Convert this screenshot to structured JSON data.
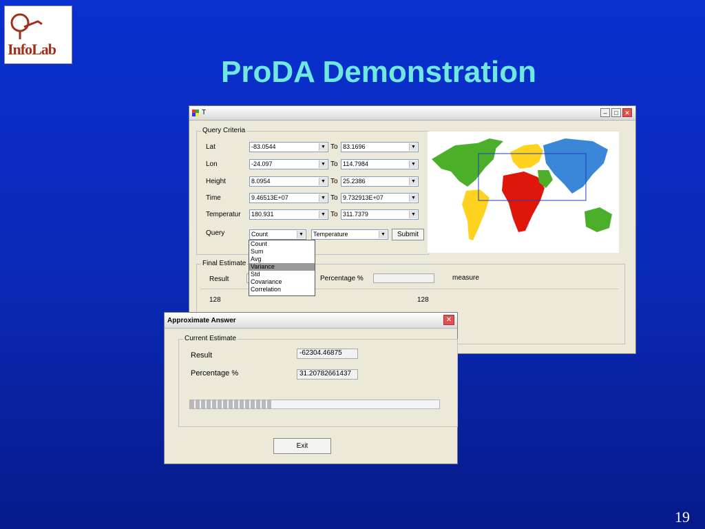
{
  "slide": {
    "title": "ProDA Demonstration",
    "page_number": "19",
    "logo_text": "InfoLab"
  },
  "main_window": {
    "title": "T",
    "query_criteria": {
      "legend": "Query Criteria",
      "to_label": "To",
      "rows": [
        {
          "label": "Lat",
          "from": "-83.0544",
          "to": "83.1696"
        },
        {
          "label": "Lon",
          "from": "-24.097",
          "to": "114.7984"
        },
        {
          "label": "Height",
          "from": "8.0954",
          "to": "25.2386"
        },
        {
          "label": "Time",
          "from": "9.46513E+07",
          "to": "9.732913E+07"
        },
        {
          "label": "Temperatur",
          "from": "180.931",
          "to": "311.7379"
        }
      ],
      "query_label": "Query",
      "query_func": "Count",
      "query_attr": "Temperature",
      "submit_label": "Submit",
      "dropdown_options": [
        "Count",
        "Sum",
        "Avg",
        "Variance",
        "Std",
        "Covariance",
        "Correlation"
      ],
      "dropdown_selected_index": 3
    },
    "final_estimate": {
      "legend": "Final Estimate",
      "result_label": "Result",
      "percentage_label": "Percentage %",
      "measure_label": "measure",
      "left_count": "128",
      "right_count": "128"
    }
  },
  "dialog": {
    "title": "Approximate Answer",
    "group_legend": "Current Estimate",
    "result_label": "Result",
    "result_value": "-62304.46875",
    "percentage_label": "Percentage %",
    "percentage_value": "31.20782661437",
    "progress_fraction": 0.33,
    "exit_label": "Exit"
  },
  "colors": {
    "background": "#0a2fd0",
    "title": "#6fe8e0",
    "window": "#ece9d8"
  }
}
